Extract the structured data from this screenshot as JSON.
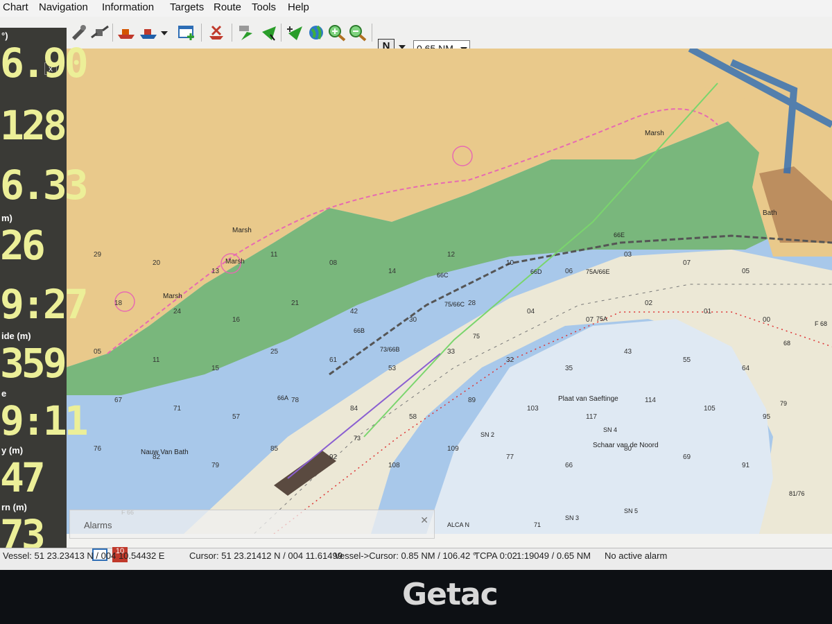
{
  "menu": [
    "Chart",
    "Navigation",
    "Information",
    "Targets",
    "Route",
    "Tools",
    "Help"
  ],
  "toolbar": {
    "north_label": "N",
    "range_value": "0.65 NM"
  },
  "side_panel": {
    "close_label": "x",
    "readouts": [
      {
        "label": "°)",
        "value": "6.90"
      },
      {
        "label": "",
        "value": "128"
      },
      {
        "label": "",
        "value": "6.33"
      },
      {
        "label": "m)",
        "value": "26"
      },
      {
        "label": "",
        "value": "9:27"
      },
      {
        "label": "ide (m)",
        "value": "359"
      },
      {
        "label": "e",
        "value": "9:11"
      },
      {
        "label": "y (m)",
        "value": "47"
      },
      {
        "label": "rn (m)",
        "value": "73"
      }
    ]
  },
  "chart": {
    "place_names": [
      "Marsh",
      "Marsh",
      "Marsh",
      "Marsh",
      "Nauw Van Bath",
      "Plaat van Saeftinge",
      "Schaar van de Noord",
      "Bath"
    ],
    "buoy_labels": [
      "66A",
      "66B",
      "66C",
      "66D",
      "66E",
      "73/66B",
      "75/66C",
      "75A/66E",
      "75A",
      "75",
      "73",
      "SN 2",
      "SN 4",
      "SN 3",
      "SN 5",
      "F 66",
      "F 68",
      "ALCA N",
      "81/76",
      "79",
      "68",
      "71"
    ],
    "soundings": [
      "29",
      "20",
      "13",
      "11",
      "08",
      "14",
      "12",
      "10",
      "06",
      "03",
      "07",
      "05",
      "18",
      "24",
      "16",
      "21",
      "42",
      "30",
      "28",
      "04",
      "07",
      "02",
      "01",
      "00",
      "05",
      "11",
      "15",
      "25",
      "61",
      "53",
      "33",
      "32",
      "35",
      "43",
      "55",
      "64",
      "67",
      "71",
      "57",
      "78",
      "84",
      "58",
      "89",
      "103",
      "117",
      "114",
      "105",
      "95",
      "76",
      "82",
      "79",
      "85",
      "92",
      "108",
      "109",
      "77",
      "66",
      "80",
      "69",
      "91"
    ]
  },
  "alarm_panel": {
    "title": "Alarms"
  },
  "status": {
    "vessel": "Vessel: 51 23.23413 N / 004 10.54432 E",
    "cursor": "Cursor: 51 23.21412 N / 004 11.61499",
    "vessel_cursor": "Vessel->Cursor: 0.85 NM / 106.42 °",
    "tcpa": "TCPA 0:02",
    "scale": "1:19049 / 0.65 NM",
    "alarm": "No active alarm",
    "alarm_count": "10"
  },
  "bezel": {
    "brand": "Getac"
  },
  "colors": {
    "land": "#e9c98b",
    "marsh": "#79b77c",
    "shallow": "#a8c8ea",
    "deep": "#dfe9f3",
    "drying": "#ece8d6",
    "panel": "#3a3a36",
    "digits": "#ecef98",
    "route": "#7ad56d",
    "boundary": "#e76ab2"
  }
}
